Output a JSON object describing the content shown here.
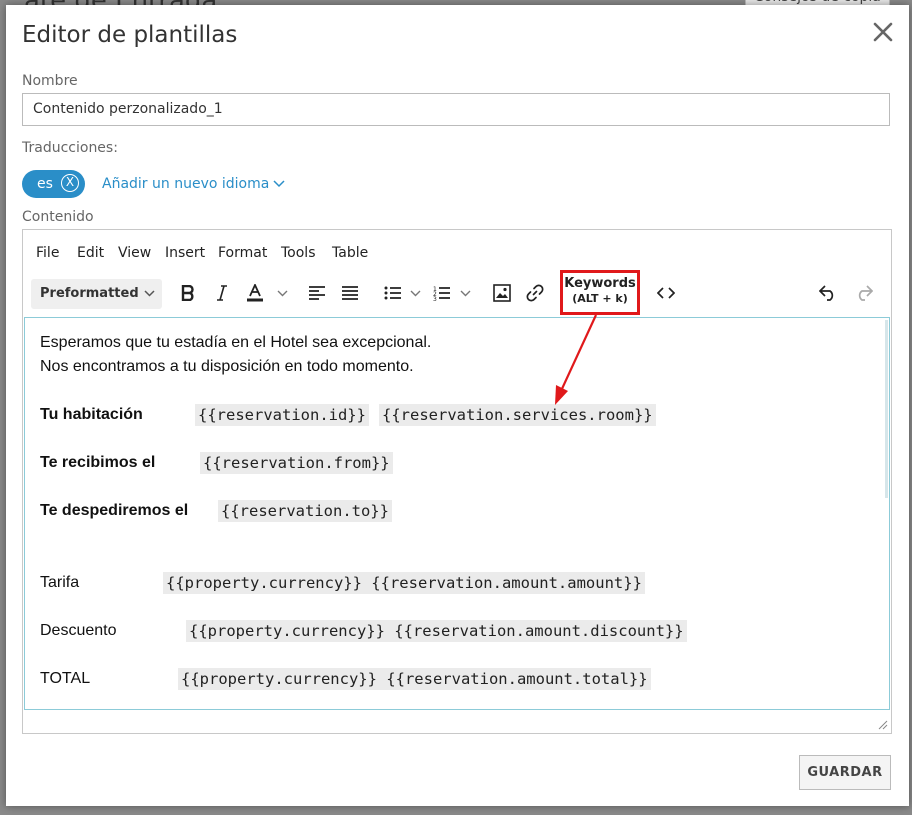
{
  "background": {
    "title_fragment": "ate de Entrada",
    "button_fragment": "Consejos de copia"
  },
  "dialog": {
    "title": "Editor de plantillas",
    "name_label": "Nombre",
    "name_value": "Contenido perzonalizado_1",
    "translations_label": "Traducciones:",
    "language_code": "es",
    "language_remove": "X",
    "add_language": "Añadir un nuevo idioma",
    "content_label": "Contenido",
    "save_label": "GUARDAR"
  },
  "editor": {
    "menu": [
      "File",
      "Edit",
      "View",
      "Insert",
      "Format",
      "Tools",
      "Table"
    ],
    "block_format": "Preformatted",
    "keywords": {
      "label": "Keywords",
      "shortcut": "(ALT + k)"
    },
    "content": {
      "intro1": "Esperamos que tu estadía en el Hotel sea excepcional.",
      "intro2": "Nos encontramos a tu disposición en todo momento.",
      "room_label": "Tu habitación",
      "room_tag1": "{{reservation.id}}",
      "room_tag2": "{{reservation.services.room}}",
      "from_label": "Te recibimos el",
      "from_tag": "{{reservation.from}}",
      "to_label": "Te despediremos el",
      "to_tag": "{{reservation.to}}",
      "rate_label": "Tarifa",
      "rate_tag": "{{property.currency}} {{reservation.amount.amount}}",
      "discount_label": "Descuento",
      "discount_tag": "{{property.currency}} {{reservation.amount.discount}}",
      "total_label": "TOTAL",
      "total_tag": "{{property.currency}} {{reservation.amount.total}}"
    }
  },
  "colors": {
    "accent": "#2a8ec8",
    "highlight": "#e0191b",
    "code_bg": "#ebebeb"
  },
  "icons": [
    "close-icon",
    "chevron-down-icon",
    "bold-icon",
    "italic-icon",
    "text-color-icon",
    "align-left-icon",
    "justify-icon",
    "bullet-list-icon",
    "numbered-list-icon",
    "image-icon",
    "link-icon",
    "source-code-icon",
    "undo-icon",
    "redo-icon",
    "resize-handle-icon"
  ]
}
